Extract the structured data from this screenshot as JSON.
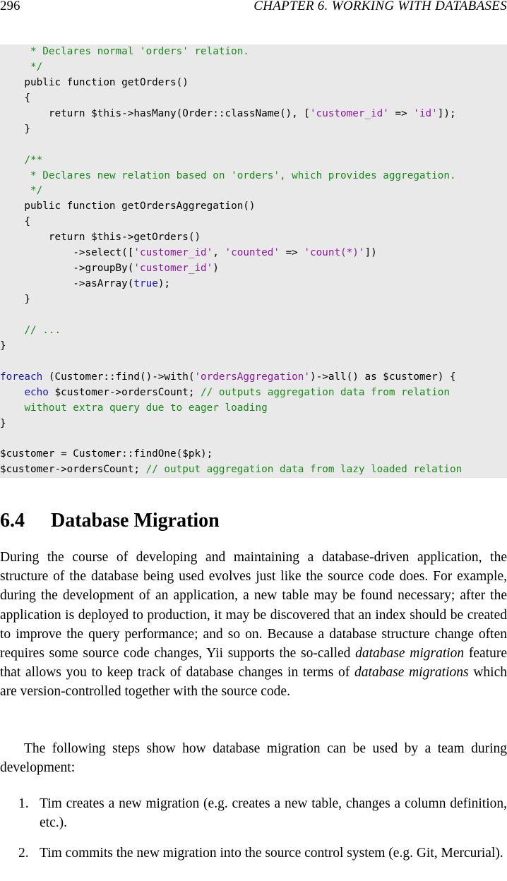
{
  "header": {
    "page_number": "296",
    "running_head": "CHAPTER 6.   WORKING WITH DATABASES"
  },
  "code": {
    "lines": [
      [
        {
          "t": "     ",
          "k": "plain"
        },
        {
          "t": "* Declares normal 'orders' relation.",
          "k": "comment"
        }
      ],
      [
        {
          "t": "     ",
          "k": "plain"
        },
        {
          "t": "*/",
          "k": "comment"
        }
      ],
      [
        {
          "t": "    public function getOrders()",
          "k": "plain"
        }
      ],
      [
        {
          "t": "    {",
          "k": "plain"
        }
      ],
      [
        {
          "t": "        return $this->hasMany(Order::className(), [",
          "k": "plain"
        },
        {
          "t": "'customer_id'",
          "k": "string"
        },
        {
          "t": " => ",
          "k": "plain"
        },
        {
          "t": "'id'",
          "k": "string"
        },
        {
          "t": "]);",
          "k": "plain"
        }
      ],
      [
        {
          "t": "    }",
          "k": "plain"
        }
      ],
      [
        {
          "t": "",
          "k": "plain"
        }
      ],
      [
        {
          "t": "    ",
          "k": "plain"
        },
        {
          "t": "/**",
          "k": "comment"
        }
      ],
      [
        {
          "t": "     ",
          "k": "plain"
        },
        {
          "t": "* Declares new relation based on 'orders', which provides aggregation.",
          "k": "comment"
        }
      ],
      [
        {
          "t": "     ",
          "k": "plain"
        },
        {
          "t": "*/",
          "k": "comment"
        }
      ],
      [
        {
          "t": "    public function getOrdersAggregation()",
          "k": "plain"
        }
      ],
      [
        {
          "t": "    {",
          "k": "plain"
        }
      ],
      [
        {
          "t": "        return $this->getOrders()",
          "k": "plain"
        }
      ],
      [
        {
          "t": "            ->select([",
          "k": "plain"
        },
        {
          "t": "'customer_id'",
          "k": "string"
        },
        {
          "t": ", ",
          "k": "plain"
        },
        {
          "t": "'counted'",
          "k": "string"
        },
        {
          "t": " => ",
          "k": "plain"
        },
        {
          "t": "'count(*)'",
          "k": "string"
        },
        {
          "t": "])",
          "k": "plain"
        }
      ],
      [
        {
          "t": "            ->groupBy(",
          "k": "plain"
        },
        {
          "t": "'customer_id'",
          "k": "string"
        },
        {
          "t": ")",
          "k": "plain"
        }
      ],
      [
        {
          "t": "            ->asArray(",
          "k": "plain"
        },
        {
          "t": "true",
          "k": "keyword"
        },
        {
          "t": ");",
          "k": "plain"
        }
      ],
      [
        {
          "t": "    }",
          "k": "plain"
        }
      ],
      [
        {
          "t": "",
          "k": "plain"
        }
      ],
      [
        {
          "t": "    ",
          "k": "plain"
        },
        {
          "t": "// ...",
          "k": "comment"
        }
      ],
      [
        {
          "t": "}",
          "k": "plain"
        }
      ],
      [
        {
          "t": "",
          "k": "plain"
        }
      ],
      [
        {
          "t": "foreach",
          "k": "keyword"
        },
        {
          "t": " (Customer::find()->with(",
          "k": "plain"
        },
        {
          "t": "'ordersAggregation'",
          "k": "string"
        },
        {
          "t": ")->all() as $customer) {",
          "k": "plain"
        }
      ],
      [
        {
          "t": "    ",
          "k": "plain"
        },
        {
          "t": "echo",
          "k": "keyword"
        },
        {
          "t": " $customer->ordersCount; ",
          "k": "plain"
        },
        {
          "t": "// outputs aggregation data from relation",
          "k": "comment"
        }
      ],
      [
        {
          "t": "    ",
          "k": "plain"
        },
        {
          "t": "without extra query due to eager loading",
          "k": "comment"
        }
      ],
      [
        {
          "t": "}",
          "k": "plain"
        }
      ],
      [
        {
          "t": "",
          "k": "plain"
        }
      ],
      [
        {
          "t": "$customer = Customer::findOne($pk);",
          "k": "plain"
        }
      ],
      [
        {
          "t": "$customer->ordersCount; ",
          "k": "plain"
        },
        {
          "t": "// output aggregation data from lazy loaded relation",
          "k": "comment"
        }
      ]
    ]
  },
  "section": {
    "number": "6.4",
    "title": "Database Migration"
  },
  "paragraph1": [
    {
      "t": "During the course of developing and maintaining a database-driven application, the structure of the database being used evolves just like the source code does. For example, during the development of an application, a new table may be found necessary; after the application is deployed to production, it may be discovered that an index should be created to improve the query performance; and so on. Because a database structure change often requires some source code changes, Yii supports the so-called ",
      "i": false
    },
    {
      "t": "database migration",
      "i": true
    },
    {
      "t": " feature that allows you to keep track of database changes in terms of ",
      "i": false
    },
    {
      "t": "database migrations",
      "i": true
    },
    {
      "t": " which are version-controlled together with the source code.",
      "i": false
    }
  ],
  "paragraph2": "The following steps show how database migration can be used by a team during development:",
  "list": [
    {
      "marker": "1.",
      "text": "Tim creates a new migration (e.g.  creates a new table, changes a column definition, etc.)."
    },
    {
      "marker": "2.",
      "text": "Tim commits the new migration into the source control system (e.g. Git, Mercurial)."
    }
  ]
}
